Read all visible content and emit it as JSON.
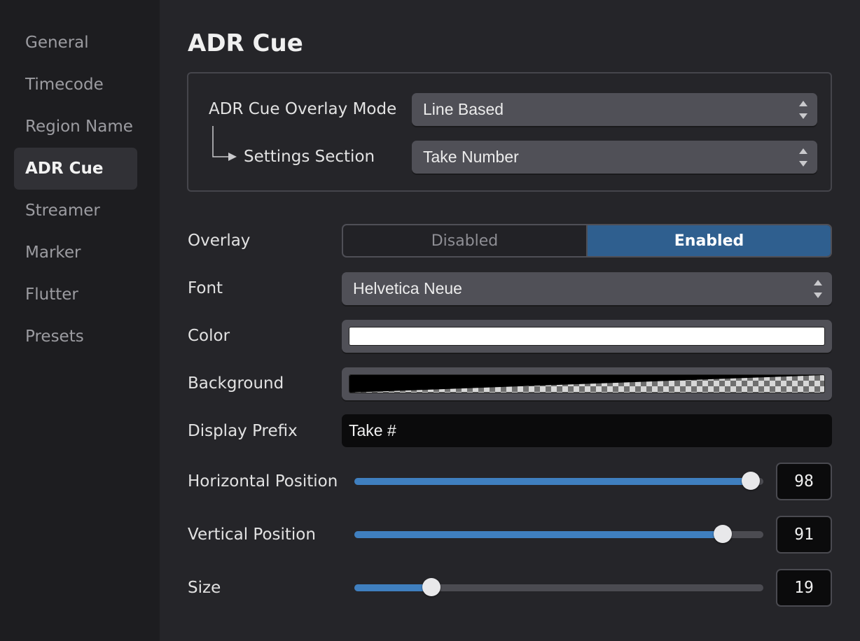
{
  "sidebar": {
    "items": [
      {
        "label": "General",
        "active": false
      },
      {
        "label": "Timecode",
        "active": false
      },
      {
        "label": "Region Name",
        "active": false
      },
      {
        "label": "ADR Cue",
        "active": true
      },
      {
        "label": "Streamer",
        "active": false
      },
      {
        "label": "Marker",
        "active": false
      },
      {
        "label": "Flutter",
        "active": false
      },
      {
        "label": "Presets",
        "active": false
      }
    ]
  },
  "page": {
    "title": "ADR Cue"
  },
  "mode_group": {
    "overlay_mode_label": "ADR Cue Overlay Mode",
    "overlay_mode_value": "Line Based",
    "settings_section_label": "Settings Section",
    "settings_section_value": "Take Number"
  },
  "overlay": {
    "label": "Overlay",
    "options": [
      "Disabled",
      "Enabled"
    ],
    "selected": "Enabled"
  },
  "font": {
    "label": "Font",
    "value": "Helvetica Neue"
  },
  "color": {
    "label": "Color",
    "value": "#ffffff"
  },
  "background": {
    "label": "Background"
  },
  "display_prefix": {
    "label": "Display Prefix",
    "value": "Take #"
  },
  "sliders": {
    "horizontal": {
      "label": "Horizontal Position",
      "value": "98",
      "fraction": 0.97
    },
    "vertical": {
      "label": "Vertical Position",
      "value": "91",
      "fraction": 0.9
    },
    "size": {
      "label": "Size",
      "value": "19",
      "fraction": 0.188
    }
  },
  "icons": {
    "stepper": "up-down-stepper-icon",
    "connector": "corner-arrow-icon"
  },
  "colors": {
    "accent": "#3f7fbf",
    "toggle_active": "#2f5f8f"
  }
}
